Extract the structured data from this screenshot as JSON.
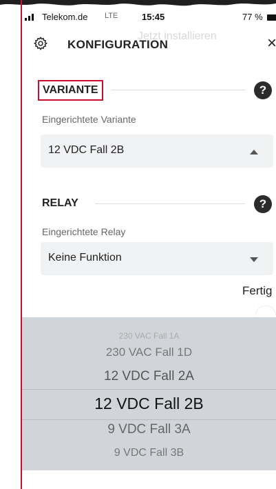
{
  "status_bar": {
    "carrier": "Telekom.de",
    "network": "LTE",
    "time": "15:45",
    "battery": "77 %"
  },
  "ghost_banner": "Jetzt installieren",
  "header": {
    "title": "KONFIGURATION",
    "close": "×"
  },
  "variante": {
    "heading": "VARIANTE",
    "help": "?",
    "field_label": "Eingerichtete Variante",
    "value": "12 VDC Fall 2B"
  },
  "relay": {
    "heading": "RELAY",
    "help": "?",
    "field_label": "Eingerichtete Relay",
    "value": "Keine Funktion"
  },
  "done_button": "Fertig",
  "picker": {
    "options": [
      "230 VAC Fall 1A",
      "230 VAC Fall 1D",
      "12 VDC Fall 2A",
      "12 VDC Fall 2B",
      "9 VDC Fall 3A",
      "9 VDC Fall 3B"
    ],
    "selected": "12 VDC Fall 2B"
  },
  "colors": {
    "accent_red": "#c8102e",
    "field_bg": "#f1f2f4",
    "picker_bg": "#d1d5da",
    "help_bg": "#2b2b2b"
  }
}
